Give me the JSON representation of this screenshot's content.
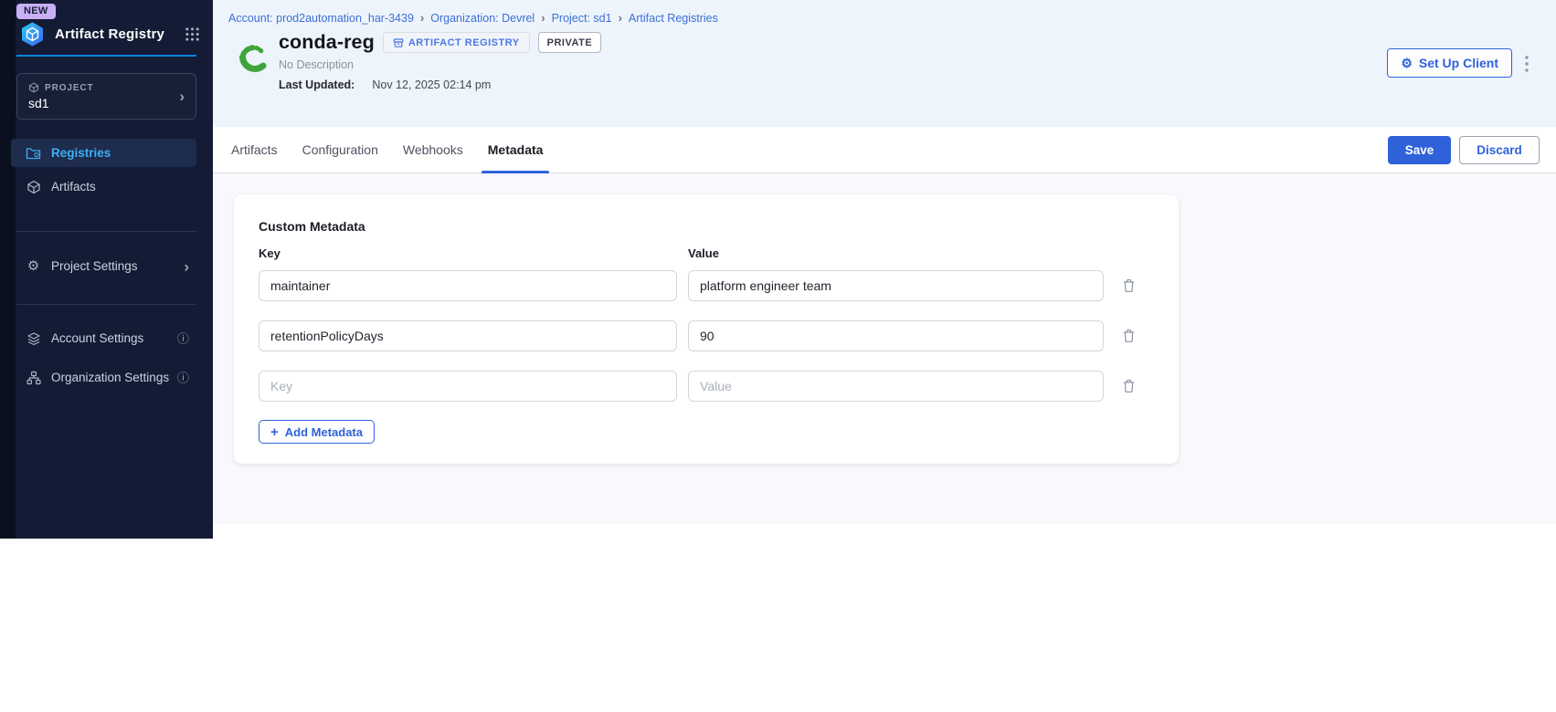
{
  "icons": {
    "chevron_right": "›",
    "breadcrumb_separator": "›",
    "info": "ⓘ",
    "gear": "⚙",
    "plus": "+"
  },
  "colors": {
    "primary_blue": "#2f62d9",
    "sidebar_bg": "#131c34",
    "sidebar_active_text": "#3eaef5",
    "header_band_bg": "#edf4fb",
    "link_blue": "#3d6fd6",
    "conda_green": "#3fa53b",
    "content_bg": "#f7f9fc"
  },
  "sidebar": {
    "new_badge": "NEW",
    "app_title": "Artifact Registry",
    "project_selector": {
      "label": "PROJECT",
      "value": "sd1"
    },
    "nav": [
      {
        "label": "Registries"
      },
      {
        "label": "Artifacts"
      },
      {
        "label": "Project Settings"
      },
      {
        "label": "Account Settings"
      },
      {
        "label": "Organization Settings"
      }
    ]
  },
  "breadcrumb": {
    "items": [
      "Account: prod2automation_har-3439",
      "Organization: Devrel",
      "Project: sd1",
      "Artifact Registries"
    ]
  },
  "header": {
    "title": "conda-reg",
    "type_badge": "ARTIFACT REGISTRY",
    "visibility_badge": "PRIVATE",
    "description": "No Description",
    "last_updated_label": "Last Updated:",
    "last_updated_value": "Nov 12, 2025 02:14 pm",
    "setup_client_label": "Set Up Client"
  },
  "tabs": {
    "items": [
      {
        "label": "Artifacts"
      },
      {
        "label": "Configuration"
      },
      {
        "label": "Webhooks"
      },
      {
        "label": "Metadata"
      }
    ],
    "active": "Metadata",
    "save_label": "Save",
    "discard_label": "Discard"
  },
  "metadata_panel": {
    "title": "Custom Metadata",
    "key_header": "Key",
    "value_header": "Value",
    "rows": [
      {
        "key": "maintainer",
        "value": "platform engineer team"
      },
      {
        "key": "retentionPolicyDays",
        "value": "90"
      },
      {
        "key": "",
        "value": "",
        "key_placeholder": "Key",
        "value_placeholder": "Value"
      }
    ],
    "add_button_label": "Add Metadata"
  }
}
